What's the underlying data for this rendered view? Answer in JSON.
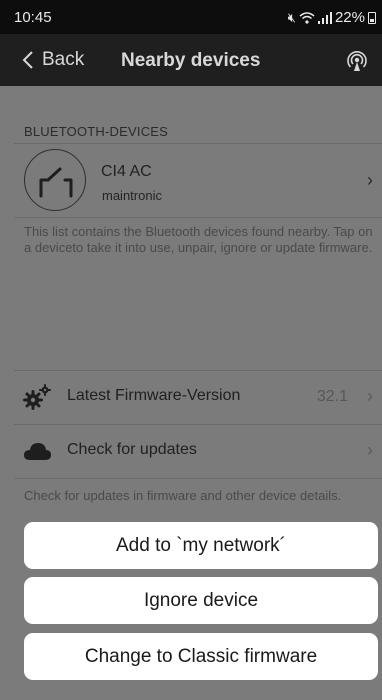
{
  "status_bar": {
    "time": "10:45",
    "battery_percent": "22%",
    "icons": [
      "mute-icon",
      "wifi-icon",
      "signal-icon",
      "battery-icon"
    ]
  },
  "nav": {
    "back_label": "Back",
    "title": "Nearby devices",
    "right_icon": "beacon-icon"
  },
  "bluetooth_section": {
    "header": "BLUETOOTH-DEVICES",
    "devices": [
      {
        "name": "CI4 AC",
        "manufacturer": "maintronic",
        "icon": "switch-icon"
      }
    ],
    "hint": "This list contains the Bluetooth devices found nearby. Tap on a deviceto take it into use, unpair, ignore or update firmware."
  },
  "firmware_section": {
    "latest_label": "Latest Firmware-Version",
    "latest_value": "32.1",
    "check_label": "Check for updates",
    "hint": "Check for updates in firmware and other device details."
  },
  "action_sheet": {
    "add": "Add to `my network´",
    "ignore": "Ignore device",
    "classic": "Change to Classic firmware"
  },
  "colors": {
    "dim_background": "#7b7b7b",
    "nav_bar": "#1f1f1f",
    "status_bar": "#0d0d0d",
    "sheet_button": "#ffffff"
  }
}
